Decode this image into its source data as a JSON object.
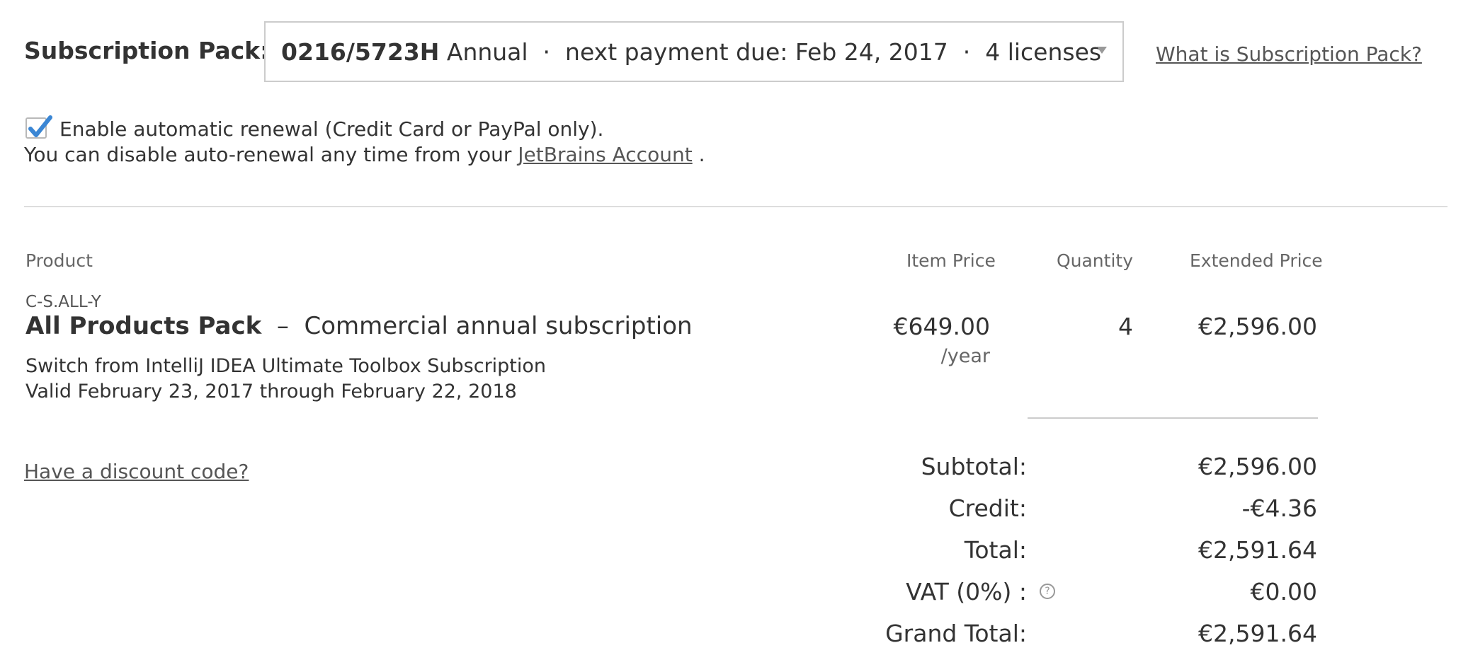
{
  "subscription": {
    "label": "Subscription Pack:",
    "selected_id": "0216/5723H",
    "selected_rest": " Annual  ·  next payment due: Feb 24, 2017  ·  4 licenses",
    "help_link": "What is Subscription Pack?"
  },
  "renewal": {
    "checked": true,
    "label": "Enable automatic renewal (Credit Card or PayPal only).",
    "note_prefix": "You can disable auto-renewal any time from your ",
    "account_link": "JetBrains Account",
    "note_suffix": " ."
  },
  "table": {
    "headers": {
      "product": "Product",
      "item_price": "Item Price",
      "quantity": "Quantity",
      "extended_price": "Extended Price"
    },
    "row": {
      "sku": "C-S.ALL-Y",
      "name": "All Products Pack",
      "separator": "  –  ",
      "edition": "Commercial annual subscription",
      "switch_note": "Switch from IntelliJ IDEA Ultimate Toolbox Subscription",
      "validity": "Valid February 23, 2017 through February 22, 2018",
      "item_price": "€649.00",
      "per": "/year",
      "quantity": "4",
      "extended_price": "€2,596.00"
    }
  },
  "discount_link": "Have a discount code?",
  "summary": {
    "subtotal_label": "Subtotal:",
    "subtotal": "€2,596.00",
    "credit_label": "Credit:",
    "credit": "-€4.36",
    "total_label": "Total:",
    "total": "€2,591.64",
    "vat_label": "VAT (0%) :",
    "vat_help": "?",
    "vat": "€0.00",
    "grand_total_label": "Grand Total:",
    "grand_total": "€2,591.64"
  },
  "colors": {
    "checkbox_check": "#3a86d4",
    "text": "#333333",
    "muted": "#666666",
    "border": "#cccccc"
  }
}
